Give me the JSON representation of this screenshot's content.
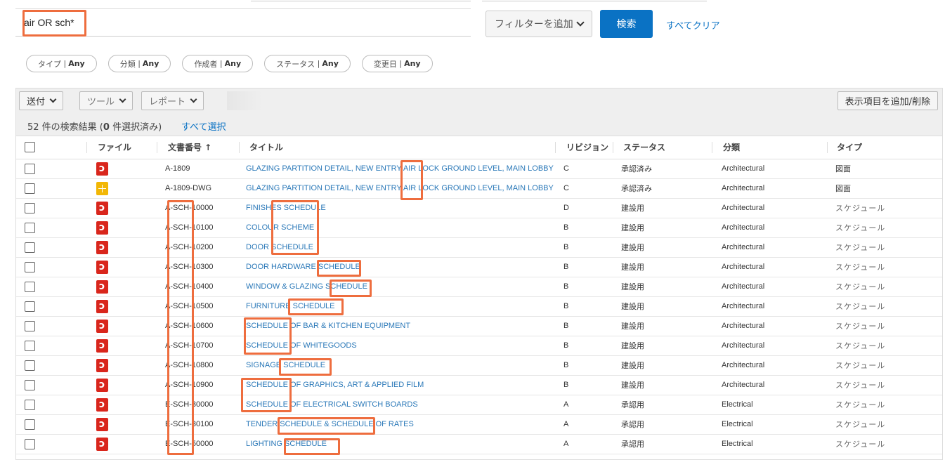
{
  "search": {
    "value": "air OR sch*"
  },
  "filter_button_label": "フィルターを追加",
  "search_button_label": "検索",
  "clear_all_label": "すべてクリア",
  "filter_chips": [
    {
      "name": "タイプ",
      "value": "Any"
    },
    {
      "name": "分類",
      "value": "Any"
    },
    {
      "name": "作成者",
      "value": "Any"
    },
    {
      "name": "ステータス",
      "value": "Any"
    },
    {
      "name": "変更日",
      "value": "Any"
    }
  ],
  "toolbar": {
    "send_label": "送付",
    "tools_label": "ツール",
    "report_label": "レポート",
    "columns_label": "表示項目を追加/削除"
  },
  "results": {
    "count": "52",
    "selected": "0",
    "count_prefix": " 件の検索結果 (",
    "count_suffix": " 件選択済み)",
    "select_all_label": "すべて選択"
  },
  "columns": [
    "ファイル",
    "文書番号 ↑",
    "タイトル",
    "リビジョン",
    "ステータス",
    "分類",
    "タイプ"
  ],
  "rows": [
    {
      "file": "pdf",
      "doc": "A-1809",
      "title": "GLAZING PARTITION DETAIL, NEW ENTRY AIR LOCK GROUND LEVEL, MAIN LOBBY",
      "rev": "C",
      "status": "承認済み",
      "discipline": "Architectural",
      "type": "図面"
    },
    {
      "file": "dwg",
      "doc": "A-1809-DWG",
      "title": "GLAZING PARTITION DETAIL, NEW ENTRY AIR LOCK GROUND LEVEL, MAIN LOBBY",
      "rev": "C",
      "status": "承認済み",
      "discipline": "Architectural",
      "type": "図面"
    },
    {
      "file": "pdf",
      "doc": "A-SCH-10000",
      "title": "FINISHES SCHEDULE",
      "rev": "D",
      "status": "建設用",
      "discipline": "Architectural",
      "type": "スケジュール"
    },
    {
      "file": "pdf",
      "doc": "A-SCH-10100",
      "title": "COLOUR SCHEME",
      "rev": "B",
      "status": "建設用",
      "discipline": "Architectural",
      "type": "スケジュール"
    },
    {
      "file": "pdf",
      "doc": "A-SCH-10200",
      "title": "DOOR SCHEDULE",
      "rev": "B",
      "status": "建設用",
      "discipline": "Architectural",
      "type": "スケジュール"
    },
    {
      "file": "pdf",
      "doc": "A-SCH-10300",
      "title": "DOOR HARDWARE SCHEDULE",
      "rev": "B",
      "status": "建設用",
      "discipline": "Architectural",
      "type": "スケジュール"
    },
    {
      "file": "pdf",
      "doc": "A-SCH-10400",
      "title": "WINDOW & GLAZING SCHEDULE",
      "rev": "B",
      "status": "建設用",
      "discipline": "Architectural",
      "type": "スケジュール"
    },
    {
      "file": "pdf",
      "doc": "A-SCH-10500",
      "title": "FURNITURE SCHEDULE",
      "rev": "B",
      "status": "建設用",
      "discipline": "Architectural",
      "type": "スケジュール"
    },
    {
      "file": "pdf",
      "doc": "A-SCH-10600",
      "title": "SCHEDULE OF BAR & KITCHEN EQUIPMENT",
      "rev": "B",
      "status": "建設用",
      "discipline": "Architectural",
      "type": "スケジュール"
    },
    {
      "file": "pdf",
      "doc": "A-SCH-10700",
      "title": "SCHEDULE OF WHITEGOODS",
      "rev": "B",
      "status": "建設用",
      "discipline": "Architectural",
      "type": "スケジュール"
    },
    {
      "file": "pdf",
      "doc": "A-SCH-10800",
      "title": "SIGNAGE SCHEDULE",
      "rev": "B",
      "status": "建設用",
      "discipline": "Architectural",
      "type": "スケジュール"
    },
    {
      "file": "pdf",
      "doc": "A-SCH-10900",
      "title": "SCHEDULE OF GRAPHICS, ART & APPLIED FILM",
      "rev": "B",
      "status": "建設用",
      "discipline": "Architectural",
      "type": "スケジュール"
    },
    {
      "file": "pdf",
      "doc": "E-SCH-30000",
      "title": "SCHEDULE OF ELECTRICAL SWITCH BOARDS",
      "rev": "A",
      "status": "承認用",
      "discipline": "Electrical",
      "type": "スケジュール"
    },
    {
      "file": "pdf",
      "doc": "E-SCH-30100",
      "title": "TENDER SCHEDULE & SCHEDULE OF RATES",
      "rev": "A",
      "status": "承認用",
      "discipline": "Electrical",
      "type": "スケジュール"
    },
    {
      "file": "pdf",
      "doc": "E-SCH-50000",
      "title": "LIGHTING SCHEDULE",
      "rev": "A",
      "status": "承認用",
      "discipline": "Electrical",
      "type": "スケジュール"
    }
  ],
  "colors": {
    "accent": "#0a72c4",
    "highlight": "#ee6d3e",
    "pdf": "#d9261c",
    "dwg": "#f2b705",
    "link": "#2a78b8"
  }
}
